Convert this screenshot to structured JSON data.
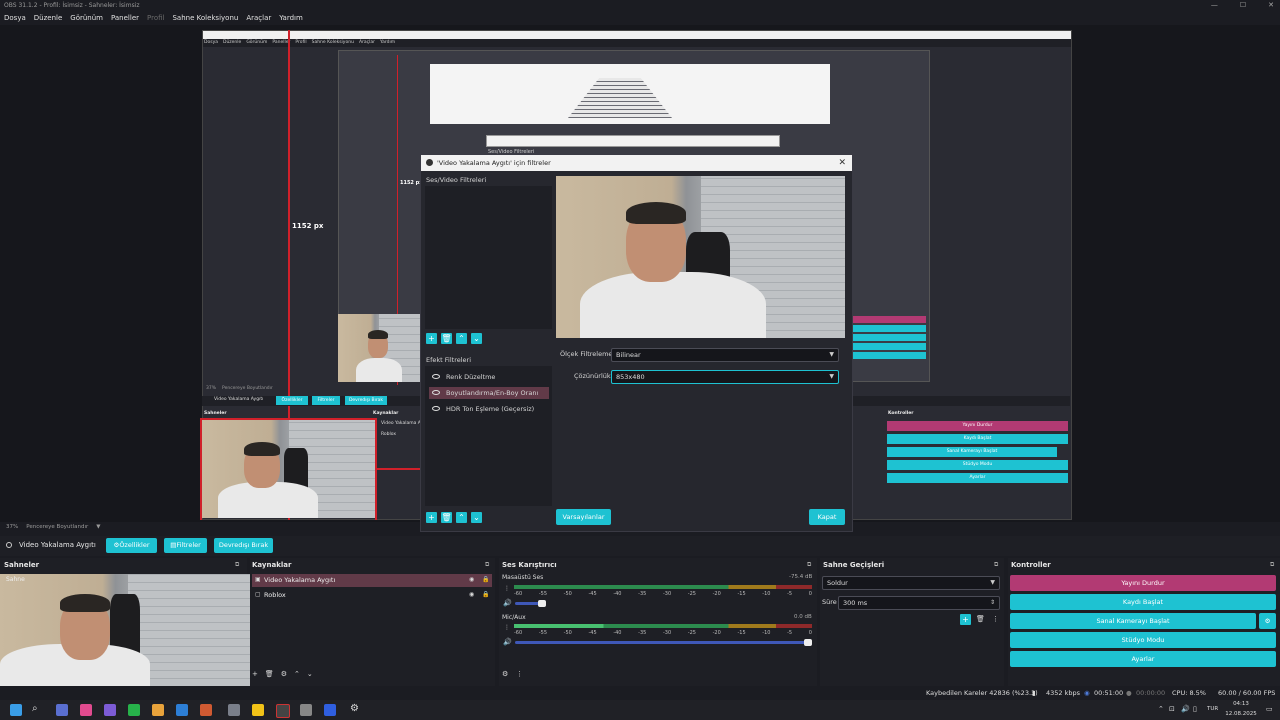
{
  "window": {
    "title": "OBS 31.1.2 - Profil: İsimsiz - Sahneler: İsimsiz"
  },
  "menu": {
    "items": [
      "Dosya",
      "Düzenle",
      "Görünüm",
      "Paneller",
      "Profil",
      "Sahne Koleksiyonu",
      "Araçlar",
      "Yardım"
    ]
  },
  "nested": {
    "dialog_title": "Video Yakalama Aygıtı için filtreler",
    "audio_video_filters": "Ses/Video Filtreleri",
    "measure_label_big": "1152 px",
    "measure_label_small": "1152 px",
    "inner_sources_header": "Kaynaklar",
    "inner_scenes_header": "Sahneler",
    "inner_controls_header": "Kontroller",
    "inner_source_1": "Video Yakalama Aygıtı",
    "inner_source_2": "Roblox",
    "inner_props": "Özellikler",
    "inner_filters": "Filtreler",
    "inner_deact": "Devredışı Bırak",
    "inner_ctrl": [
      "Yayını Durdur",
      "Kaydı Başlat",
      "Sanal Kamerayı Başlat",
      "Stüdyo Modu",
      "Ayarlar"
    ],
    "inner_zoom": "37%",
    "inner_preview_label": "Pencereye Boyutlandır"
  },
  "filters_dialog": {
    "title": "'Video Yakalama Aygıtı' için filtreler",
    "av_filters_label": "Ses/Video Filtreleri",
    "effect_filters_label": "Efekt Filtreleri",
    "effects": [
      "Renk Düzeltme",
      "Boyutlandırma/En-Boy Oranı",
      "HDR Ton Eşleme (Geçersiz)"
    ],
    "selected_effect": 1,
    "scale_filter_label": "Ölçek Filtreleme",
    "scale_filter_value": "Bilinear",
    "resolution_label": "Çözünürlük",
    "resolution_value": "853x480",
    "defaults_button": "Varsayılanlar",
    "close_button": "Kapat"
  },
  "preview_bar": {
    "zoom": "37%",
    "fit": "Pencereye Boyutlandır"
  },
  "source_toolbar": {
    "source": "Video Yakalama Aygıtı",
    "properties": "Özellikler",
    "filters": "Filtreler",
    "deactivate": "Devredışı Bırak"
  },
  "scenes": {
    "header": "Sahneler",
    "scene_name": "Sahne"
  },
  "sources": {
    "header": "Kaynaklar",
    "items": [
      "Video Yakalama Aygıtı",
      "Roblox"
    ]
  },
  "mixer": {
    "header": "Ses Karıştırıcı",
    "ticks": [
      "-60",
      "-55",
      "-50",
      "-45",
      "-40",
      "-35",
      "-30",
      "-25",
      "-20",
      "-15",
      "-10",
      "-5",
      "0"
    ],
    "channels": [
      {
        "name": "Masaüstü Ses",
        "db": "-75.4 dB"
      },
      {
        "name": "Mic/Aux",
        "db": "0.0 dB"
      }
    ]
  },
  "transitions": {
    "header": "Sahne Geçişleri",
    "type": "Soldur",
    "duration_label": "Süre",
    "duration_value": "300 ms"
  },
  "controls": {
    "header": "Kontroller",
    "buttons": [
      "Yayını Durdur",
      "Kaydı Başlat",
      "Sanal Kamerayı Başlat",
      "Stüdyo Modu",
      "Ayarlar"
    ]
  },
  "status": {
    "dropped": "Kaybedilen Kareler 42836 (%23.3)",
    "kbps": "4352 kbps",
    "stream_time": "00:51:00",
    "rec_time": "00:00:00",
    "cpu": "CPU: 8.5%",
    "fps": "60.00 / 60.00 FPS"
  },
  "taskbar": {
    "lang": "TUR",
    "time": "04:13",
    "date": "12.08.2025"
  },
  "colors": {
    "accent": "#1ec2d2",
    "stop": "#b23a73",
    "selection_red": "#d0202a"
  }
}
